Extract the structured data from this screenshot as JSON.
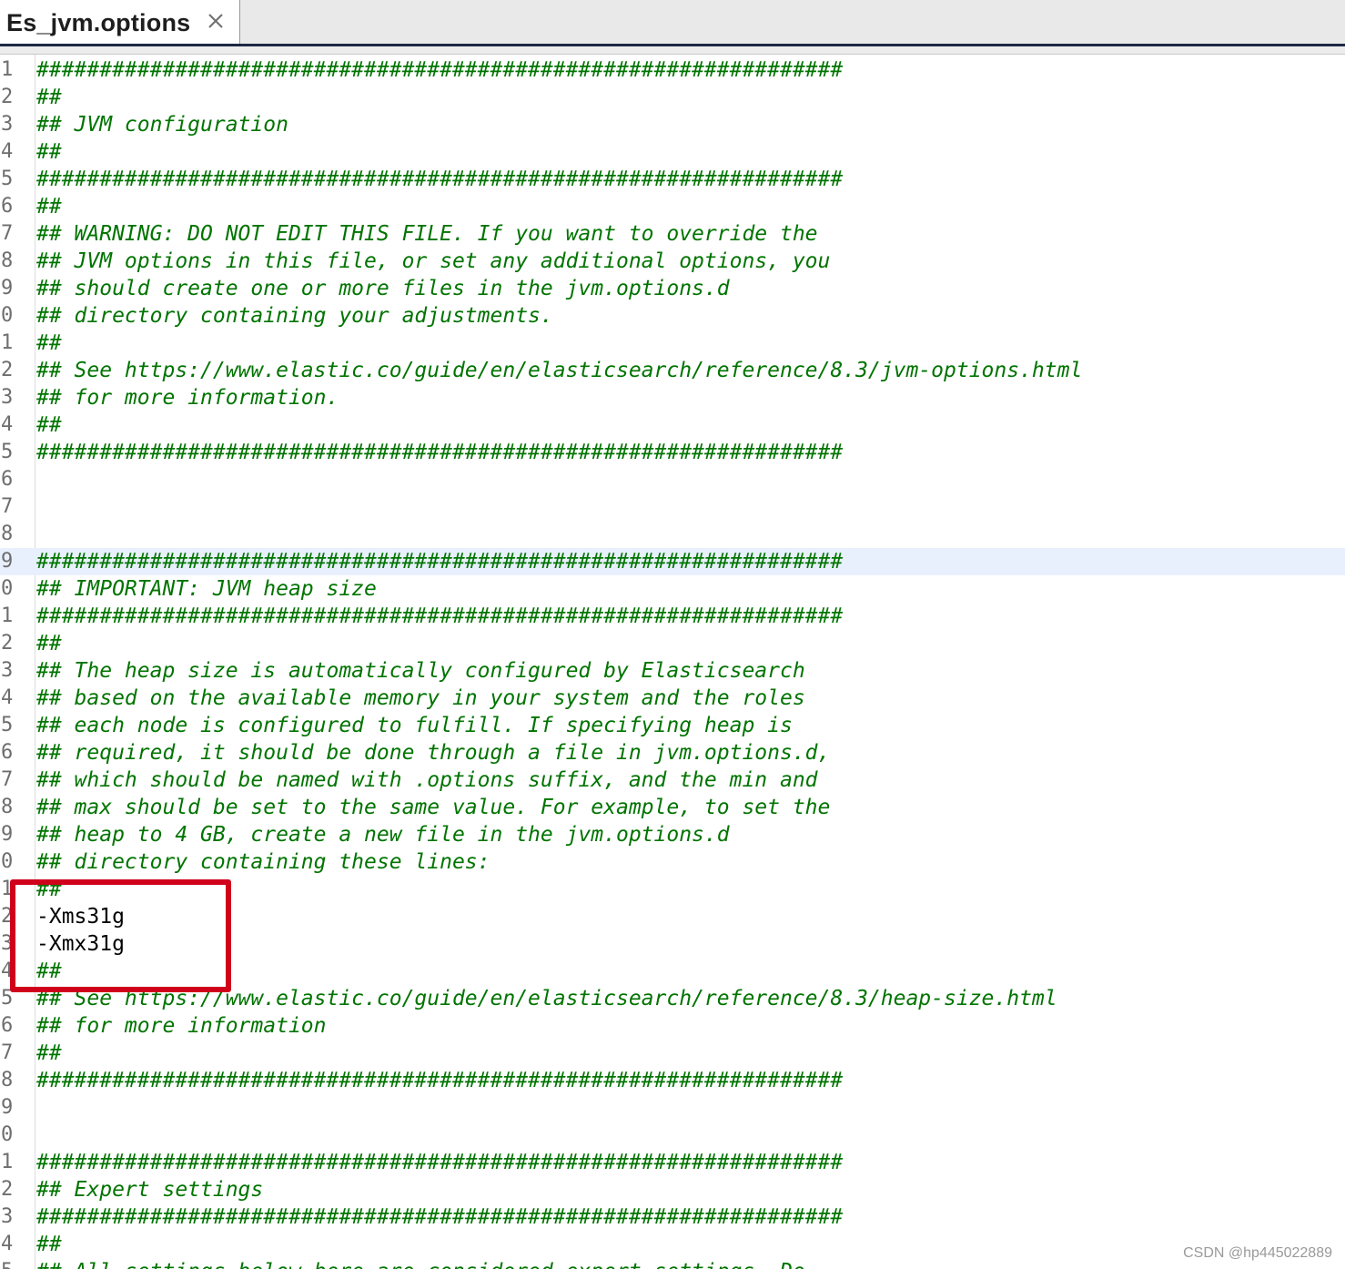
{
  "tab": {
    "title": "Es_jvm.options",
    "close_icon": "close-icon"
  },
  "colors": {
    "comment": "#007400",
    "current_line": "#e8f0fd",
    "annotation_box": "#d0021b"
  },
  "editor": {
    "current_line_index": 18,
    "lines": [
      {
        "n": "1",
        "text": "################################################################",
        "kind": "comment"
      },
      {
        "n": "2",
        "text": "##",
        "kind": "comment"
      },
      {
        "n": "3",
        "text": "## JVM configuration",
        "kind": "comment"
      },
      {
        "n": "4",
        "text": "##",
        "kind": "comment"
      },
      {
        "n": "5",
        "text": "################################################################",
        "kind": "comment"
      },
      {
        "n": "6",
        "text": "##",
        "kind": "comment"
      },
      {
        "n": "7",
        "text": "## WARNING: DO NOT EDIT THIS FILE. If you want to override the",
        "kind": "comment"
      },
      {
        "n": "8",
        "text": "## JVM options in this file, or set any additional options, you",
        "kind": "comment"
      },
      {
        "n": "9",
        "text": "## should create one or more files in the jvm.options.d",
        "kind": "comment"
      },
      {
        "n": "0",
        "text": "## directory containing your adjustments.",
        "kind": "comment"
      },
      {
        "n": "1",
        "text": "##",
        "kind": "comment"
      },
      {
        "n": "2",
        "text": "## See https://www.elastic.co/guide/en/elasticsearch/reference/8.3/jvm-options.html",
        "kind": "comment"
      },
      {
        "n": "3",
        "text": "## for more information.",
        "kind": "comment"
      },
      {
        "n": "4",
        "text": "##",
        "kind": "comment"
      },
      {
        "n": "5",
        "text": "################################################################",
        "kind": "comment"
      },
      {
        "n": "6",
        "text": "",
        "kind": "comment"
      },
      {
        "n": "7",
        "text": "",
        "kind": "comment"
      },
      {
        "n": "8",
        "text": "",
        "kind": "comment"
      },
      {
        "n": "9",
        "text": "################################################################",
        "kind": "comment"
      },
      {
        "n": "0",
        "text": "## IMPORTANT: JVM heap size",
        "kind": "comment"
      },
      {
        "n": "1",
        "text": "################################################################",
        "kind": "comment"
      },
      {
        "n": "2",
        "text": "##",
        "kind": "comment"
      },
      {
        "n": "3",
        "text": "## The heap size is automatically configured by Elasticsearch",
        "kind": "comment"
      },
      {
        "n": "4",
        "text": "## based on the available memory in your system and the roles",
        "kind": "comment"
      },
      {
        "n": "5",
        "text": "## each node is configured to fulfill. If specifying heap is",
        "kind": "comment"
      },
      {
        "n": "6",
        "text": "## required, it should be done through a file in jvm.options.d,",
        "kind": "comment"
      },
      {
        "n": "7",
        "text": "## which should be named with .options suffix, and the min and",
        "kind": "comment"
      },
      {
        "n": "8",
        "text": "## max should be set to the same value. For example, to set the",
        "kind": "comment"
      },
      {
        "n": "9",
        "text": "## heap to 4 GB, create a new file in the jvm.options.d",
        "kind": "comment"
      },
      {
        "n": "0",
        "text": "## directory containing these lines:",
        "kind": "comment"
      },
      {
        "n": "1",
        "text": "##",
        "kind": "comment"
      },
      {
        "n": "2",
        "text": "-Xms31g",
        "kind": "option"
      },
      {
        "n": "3",
        "text": "-Xmx31g",
        "kind": "option"
      },
      {
        "n": "4",
        "text": "##",
        "kind": "comment"
      },
      {
        "n": "5",
        "text": "## See https://www.elastic.co/guide/en/elasticsearch/reference/8.3/heap-size.html",
        "kind": "comment"
      },
      {
        "n": "6",
        "text": "## for more information",
        "kind": "comment"
      },
      {
        "n": "7",
        "text": "##",
        "kind": "comment"
      },
      {
        "n": "8",
        "text": "################################################################",
        "kind": "comment"
      },
      {
        "n": "9",
        "text": "",
        "kind": "comment"
      },
      {
        "n": "0",
        "text": "",
        "kind": "comment"
      },
      {
        "n": "1",
        "text": "################################################################",
        "kind": "comment"
      },
      {
        "n": "2",
        "text": "## Expert settings",
        "kind": "comment"
      },
      {
        "n": "3",
        "text": "################################################################",
        "kind": "comment"
      },
      {
        "n": "4",
        "text": "##",
        "kind": "comment"
      },
      {
        "n": "5",
        "text": "## All settings below here are considered expert settings. Do",
        "kind": "comment"
      }
    ]
  },
  "watermark": "CSDN @hp445022889"
}
